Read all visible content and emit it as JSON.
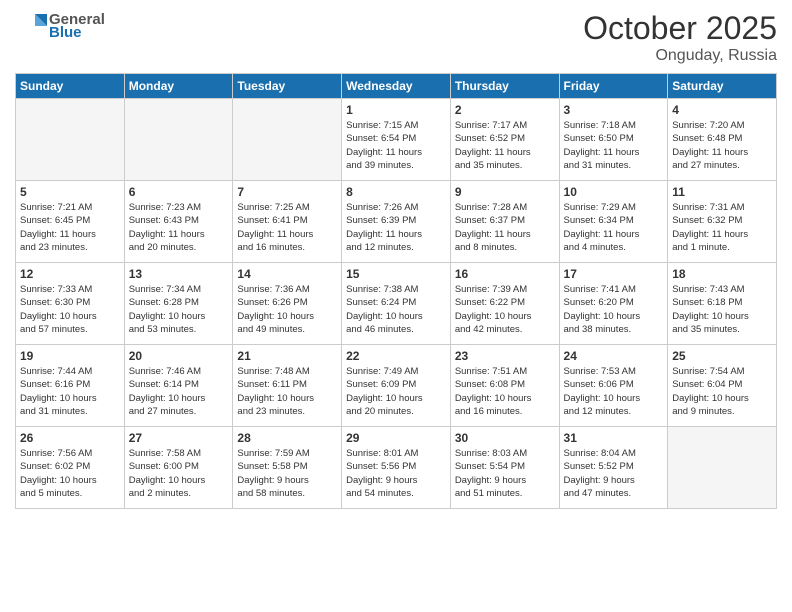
{
  "header": {
    "logo_general": "General",
    "logo_blue": "Blue",
    "month_year": "October 2025",
    "location": "Onguday, Russia"
  },
  "days_of_week": [
    "Sunday",
    "Monday",
    "Tuesday",
    "Wednesday",
    "Thursday",
    "Friday",
    "Saturday"
  ],
  "weeks": [
    [
      {
        "num": "",
        "info": ""
      },
      {
        "num": "",
        "info": ""
      },
      {
        "num": "",
        "info": ""
      },
      {
        "num": "1",
        "info": "Sunrise: 7:15 AM\nSunset: 6:54 PM\nDaylight: 11 hours\nand 39 minutes."
      },
      {
        "num": "2",
        "info": "Sunrise: 7:17 AM\nSunset: 6:52 PM\nDaylight: 11 hours\nand 35 minutes."
      },
      {
        "num": "3",
        "info": "Sunrise: 7:18 AM\nSunset: 6:50 PM\nDaylight: 11 hours\nand 31 minutes."
      },
      {
        "num": "4",
        "info": "Sunrise: 7:20 AM\nSunset: 6:48 PM\nDaylight: 11 hours\nand 27 minutes."
      }
    ],
    [
      {
        "num": "5",
        "info": "Sunrise: 7:21 AM\nSunset: 6:45 PM\nDaylight: 11 hours\nand 23 minutes."
      },
      {
        "num": "6",
        "info": "Sunrise: 7:23 AM\nSunset: 6:43 PM\nDaylight: 11 hours\nand 20 minutes."
      },
      {
        "num": "7",
        "info": "Sunrise: 7:25 AM\nSunset: 6:41 PM\nDaylight: 11 hours\nand 16 minutes."
      },
      {
        "num": "8",
        "info": "Sunrise: 7:26 AM\nSunset: 6:39 PM\nDaylight: 11 hours\nand 12 minutes."
      },
      {
        "num": "9",
        "info": "Sunrise: 7:28 AM\nSunset: 6:37 PM\nDaylight: 11 hours\nand 8 minutes."
      },
      {
        "num": "10",
        "info": "Sunrise: 7:29 AM\nSunset: 6:34 PM\nDaylight: 11 hours\nand 4 minutes."
      },
      {
        "num": "11",
        "info": "Sunrise: 7:31 AM\nSunset: 6:32 PM\nDaylight: 11 hours\nand 1 minute."
      }
    ],
    [
      {
        "num": "12",
        "info": "Sunrise: 7:33 AM\nSunset: 6:30 PM\nDaylight: 10 hours\nand 57 minutes."
      },
      {
        "num": "13",
        "info": "Sunrise: 7:34 AM\nSunset: 6:28 PM\nDaylight: 10 hours\nand 53 minutes."
      },
      {
        "num": "14",
        "info": "Sunrise: 7:36 AM\nSunset: 6:26 PM\nDaylight: 10 hours\nand 49 minutes."
      },
      {
        "num": "15",
        "info": "Sunrise: 7:38 AM\nSunset: 6:24 PM\nDaylight: 10 hours\nand 46 minutes."
      },
      {
        "num": "16",
        "info": "Sunrise: 7:39 AM\nSunset: 6:22 PM\nDaylight: 10 hours\nand 42 minutes."
      },
      {
        "num": "17",
        "info": "Sunrise: 7:41 AM\nSunset: 6:20 PM\nDaylight: 10 hours\nand 38 minutes."
      },
      {
        "num": "18",
        "info": "Sunrise: 7:43 AM\nSunset: 6:18 PM\nDaylight: 10 hours\nand 35 minutes."
      }
    ],
    [
      {
        "num": "19",
        "info": "Sunrise: 7:44 AM\nSunset: 6:16 PM\nDaylight: 10 hours\nand 31 minutes."
      },
      {
        "num": "20",
        "info": "Sunrise: 7:46 AM\nSunset: 6:14 PM\nDaylight: 10 hours\nand 27 minutes."
      },
      {
        "num": "21",
        "info": "Sunrise: 7:48 AM\nSunset: 6:11 PM\nDaylight: 10 hours\nand 23 minutes."
      },
      {
        "num": "22",
        "info": "Sunrise: 7:49 AM\nSunset: 6:09 PM\nDaylight: 10 hours\nand 20 minutes."
      },
      {
        "num": "23",
        "info": "Sunrise: 7:51 AM\nSunset: 6:08 PM\nDaylight: 10 hours\nand 16 minutes."
      },
      {
        "num": "24",
        "info": "Sunrise: 7:53 AM\nSunset: 6:06 PM\nDaylight: 10 hours\nand 12 minutes."
      },
      {
        "num": "25",
        "info": "Sunrise: 7:54 AM\nSunset: 6:04 PM\nDaylight: 10 hours\nand 9 minutes."
      }
    ],
    [
      {
        "num": "26",
        "info": "Sunrise: 7:56 AM\nSunset: 6:02 PM\nDaylight: 10 hours\nand 5 minutes."
      },
      {
        "num": "27",
        "info": "Sunrise: 7:58 AM\nSunset: 6:00 PM\nDaylight: 10 hours\nand 2 minutes."
      },
      {
        "num": "28",
        "info": "Sunrise: 7:59 AM\nSunset: 5:58 PM\nDaylight: 9 hours\nand 58 minutes."
      },
      {
        "num": "29",
        "info": "Sunrise: 8:01 AM\nSunset: 5:56 PM\nDaylight: 9 hours\nand 54 minutes."
      },
      {
        "num": "30",
        "info": "Sunrise: 8:03 AM\nSunset: 5:54 PM\nDaylight: 9 hours\nand 51 minutes."
      },
      {
        "num": "31",
        "info": "Sunrise: 8:04 AM\nSunset: 5:52 PM\nDaylight: 9 hours\nand 47 minutes."
      },
      {
        "num": "",
        "info": ""
      }
    ]
  ]
}
